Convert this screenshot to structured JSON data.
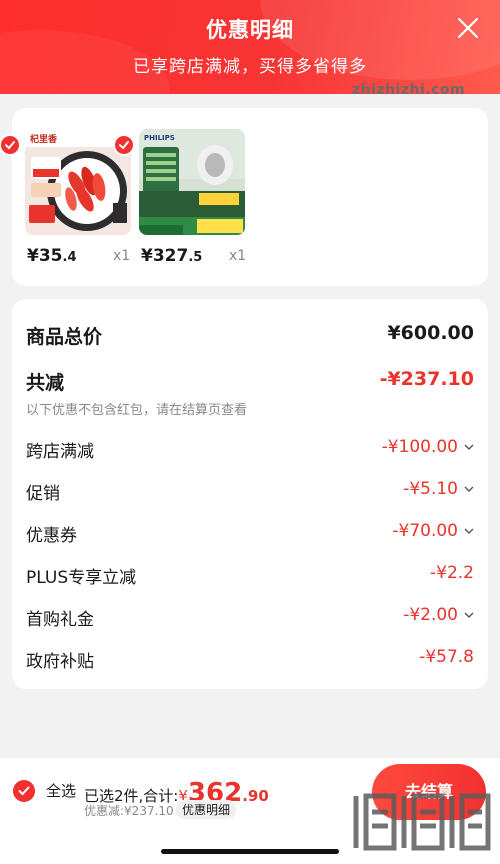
{
  "header": {
    "title": "优惠明细",
    "subtitle": "已享跨店满减，买得多省得多",
    "close_icon": "close-icon"
  },
  "products": [
    {
      "brand_logo": "杞里香",
      "price_main": "¥35",
      "price_cents": ".4",
      "qty": "x1",
      "selected": true
    },
    {
      "brand_logo": "PHILIPS",
      "price_main": "¥327",
      "price_cents": ".5",
      "qty": "x1",
      "selected": true
    }
  ],
  "details": {
    "total": {
      "label": "商品总价",
      "value": "¥600.00"
    },
    "reduction": {
      "label": "共减",
      "value": "-¥237.10",
      "note": "以下优惠不包含红包，请在结算页查看"
    },
    "items": [
      {
        "label": "跨店满减",
        "value": "-¥100.00",
        "expandable": true
      },
      {
        "label": "促销",
        "value": "-¥5.10",
        "expandable": true
      },
      {
        "label": "优惠券",
        "value": "-¥70.00",
        "expandable": true
      },
      {
        "label": "PLUS专享立减",
        "value": "-¥2.2",
        "expandable": false
      },
      {
        "label": "首购礼金",
        "value": "-¥2.00",
        "expandable": true
      },
      {
        "label": "政府补贴",
        "value": "-¥57.8",
        "expandable": false
      }
    ]
  },
  "bottom": {
    "select_all": "全选",
    "selected_text": "已选2件,合计:",
    "yen": "¥",
    "total_main": "362",
    "total_cents": ".90",
    "discount": "优惠减:¥237.10",
    "detail_chip": "优惠明细",
    "checkout": "去结算"
  },
  "watermark": {
    "site": "zhizhizhi.com"
  },
  "colors": {
    "accent": "#f23030",
    "price_red": "#e8342c",
    "header_start": "#ff2d2d",
    "header_end": "#ff5a4e"
  }
}
